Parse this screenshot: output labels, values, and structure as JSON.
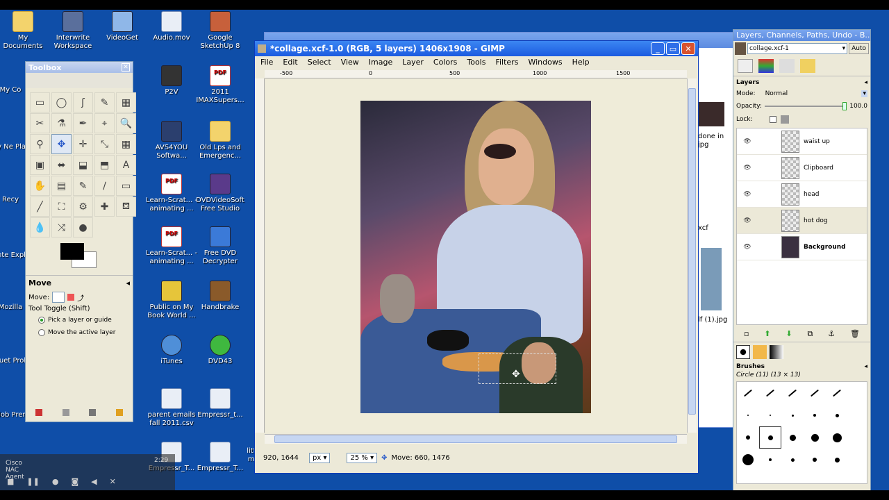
{
  "desktop_icons": [
    {
      "label": "My Documents",
      "type": "folder"
    },
    {
      "label": "Interwrite Workspace",
      "type": "app"
    },
    {
      "label": "VideoGet",
      "type": "app"
    },
    {
      "label": "Audio.mov",
      "type": "mpg"
    },
    {
      "label": "Google SketchUp 8",
      "type": "app"
    },
    {
      "label": "P2V",
      "type": "app"
    },
    {
      "label": "2011 IMAXSupers...",
      "type": "pdf"
    },
    {
      "label": "AVS4YOU Softwa...",
      "type": "app"
    },
    {
      "label": "Old Lps and Emergenc...",
      "type": "folder"
    },
    {
      "label": "Learn-Scrat... - animating ...",
      "type": "pdf"
    },
    {
      "label": "DVDVideoSoft Free Studio",
      "type": "app"
    },
    {
      "label": "Learn-Scrat... - animating ...",
      "type": "pdf"
    },
    {
      "label": "Free DVD Decrypter",
      "type": "app"
    },
    {
      "label": "Public on My Book World ...",
      "type": "app"
    },
    {
      "label": "Handbrake",
      "type": "app"
    },
    {
      "label": "iTunes",
      "type": "app"
    },
    {
      "label": "DVD43",
      "type": "app"
    },
    {
      "label": "parent emails fall 2011.csv",
      "type": "mpg"
    },
    {
      "label": "Empressr_t...",
      "type": "mpg"
    },
    {
      "label": "Empressr_T...",
      "type": "mpg"
    },
    {
      "label": "Empressr_T...",
      "type": "mpg"
    },
    {
      "label": "little girl and my head t...",
      "type": "pdf"
    }
  ],
  "left_edge_labels": [
    "My Co",
    "My Ne Plac",
    "Recy",
    "Inte Expl",
    "Mozilla",
    "Bluet Prob",
    "Adob Prem",
    "Cisco NAC Agent"
  ],
  "toolbox": {
    "title": "Toolbox",
    "tools": [
      "▭",
      "◯",
      "ʃ",
      "✎",
      "▦",
      "✂",
      "⚗",
      "✒",
      "⌖",
      "🔍",
      "⚲",
      "✥",
      "✛",
      "⤡",
      "▦",
      "▣",
      "⬌",
      "⬓",
      "⬒",
      "A",
      "✋",
      "▤",
      "✎",
      "∕",
      "▭",
      "╱",
      "⛶",
      "⚙",
      "✚",
      "⛾",
      "💧",
      "⤨",
      "●"
    ],
    "options_title": "Move",
    "move_label": "Move:",
    "toggle_label": "Tool Toggle  (Shift)",
    "opt1": "Pick a layer or guide",
    "opt2": "Move the active layer"
  },
  "gimp": {
    "title": "*collage.xcf-1.0 (RGB, 5 layers) 1406x1908 - GIMP",
    "menu": [
      "File",
      "Edit",
      "Select",
      "View",
      "Image",
      "Layer",
      "Colors",
      "Tools",
      "Filters",
      "Windows",
      "Help"
    ],
    "ruler_ticks": [
      "-500",
      "0",
      "500",
      "1000",
      "1500"
    ],
    "coords": "920, 1644",
    "unit": "px",
    "zoom": "25 %",
    "status": "Move: 660, 1476"
  },
  "layers_dialog": {
    "title": "Layers, Channels, Paths, Undo - B...",
    "image_select": "collage.xcf-1",
    "auto": "Auto",
    "section": "Layers",
    "mode_label": "Mode:",
    "mode_value": "Normal",
    "opacity_label": "Opacity:",
    "opacity_value": "100.0",
    "lock_label": "Lock:",
    "layers": [
      {
        "name": "waist up",
        "bold": false
      },
      {
        "name": "Clipboard",
        "bold": false
      },
      {
        "name": "head",
        "bold": false
      },
      {
        "name": "hot dog",
        "bold": false
      },
      {
        "name": "Background",
        "bold": true
      }
    ],
    "brushes_title": "Brushes",
    "brush_name": "Circle (11) (13 × 13)"
  },
  "behind_window": {
    "snips": [
      "done in",
      "jpg",
      "xcf",
      "lf (1).jpg"
    ]
  },
  "taskbar": {
    "time": "2:29"
  },
  "colors": {
    "desktop": "#0f4ea8",
    "titlebar": "#1c5be0",
    "canvas_bg": "#efecd9"
  }
}
